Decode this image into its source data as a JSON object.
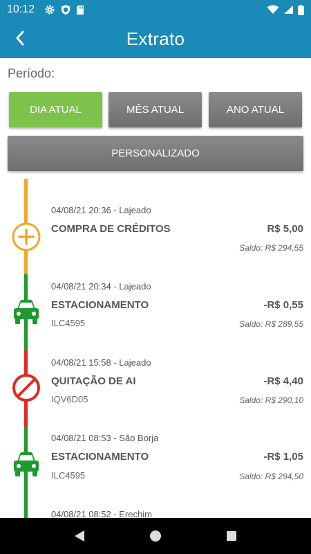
{
  "status_bar": {
    "time": "10:12",
    "left_icons": [
      "gear-icon",
      "shield-icon",
      "sd-card-icon"
    ],
    "right_icons": [
      "wifi-icon",
      "signal-icon",
      "battery-icon"
    ]
  },
  "header": {
    "title": "Extrato"
  },
  "period": {
    "label": "Período:",
    "buttons": {
      "day": "DIA ATUAL",
      "month": "MÊS ATUAL",
      "year": "ANO ATUAL",
      "custom": "PERSONALIZADO"
    },
    "selected": "day"
  },
  "colors": {
    "primary": "#1a8ab8",
    "selected_button": "#7dc24b",
    "credit": "#f5a623",
    "parking": "#1e9a2e",
    "infraction": "#e02b20"
  },
  "transactions": [
    {
      "date": "04/08/21 20:36 - Lajeado",
      "title": "COMPRA DE CRÉDITOS",
      "amount": "R$ 5,00",
      "sub": "",
      "balance": "Saldo: R$ 294,55",
      "icon": "plus-circle-icon"
    },
    {
      "date": "04/08/21 20:34 - Lajeado",
      "title": "ESTACIONAMENTO",
      "amount": "-R$ 0,55",
      "sub": "ILC4595",
      "balance": "Saldo: R$ 289,55",
      "icon": "car-icon"
    },
    {
      "date": "04/08/21 15:58 - Lajeado",
      "title": "QUITAÇÃO DE AI",
      "amount": "-R$ 4,40",
      "sub": "IQV6D05",
      "balance": "Saldo: R$ 290,10",
      "icon": "prohibited-icon"
    },
    {
      "date": "04/08/21 08:53 - São Borja",
      "title": "ESTACIONAMENTO",
      "amount": "-R$ 1,05",
      "sub": "ILC4595",
      "balance": "Saldo: R$ 294,50",
      "icon": "car-icon"
    },
    {
      "date": "04/08/21 08:52 - Erechim",
      "title": "",
      "amount": "",
      "sub": "",
      "balance": "",
      "icon": ""
    }
  ],
  "nav_bar": {
    "buttons": [
      "back-triangle-icon",
      "home-circle-icon",
      "recents-square-icon"
    ]
  }
}
